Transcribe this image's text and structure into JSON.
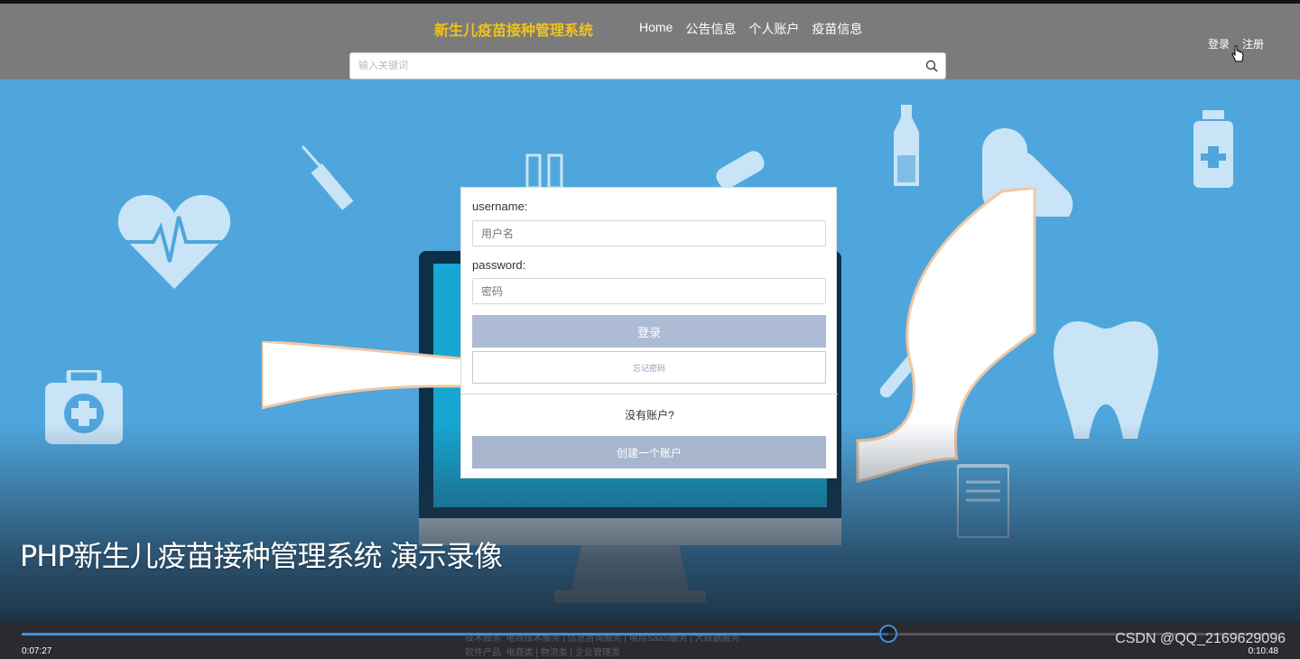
{
  "header": {
    "brand": "新生儿疫苗接种管理系统",
    "nav": [
      "Home",
      "公告信息",
      "个人账户",
      "疫苗信息"
    ],
    "login_link": "登录",
    "register_link": "注册"
  },
  "search": {
    "placeholder": "输入关键词"
  },
  "login_card": {
    "username_label": "username:",
    "username_placeholder": "用户名",
    "password_label": "password:",
    "password_placeholder": "密码",
    "login_button": "登录",
    "forgot_button": "忘记密码",
    "no_account_text": "没有账户?",
    "create_button": "创建一个账户"
  },
  "video": {
    "title": "PHP新生儿疫苗接种管理系统 演示录像",
    "current_time": "0:07:27",
    "total_time": "0:10:48",
    "progress_fraction": 0.69,
    "watermark": "CSDN @QQ_2169629096",
    "footer_line1": "技术服务:      电商技术服务 | 信息咨询服务 | 电商SaaS服务 | 大数据服务",
    "footer_line2": "软件产品:      电商类 | 物流类 | 企业管理类"
  },
  "colors": {
    "header_bg": "#7b7b7b",
    "brand": "#f2c21b",
    "hero_bg": "#4fa6dc",
    "login_button": "#adbcd4",
    "progress": "#3d8fe0"
  }
}
